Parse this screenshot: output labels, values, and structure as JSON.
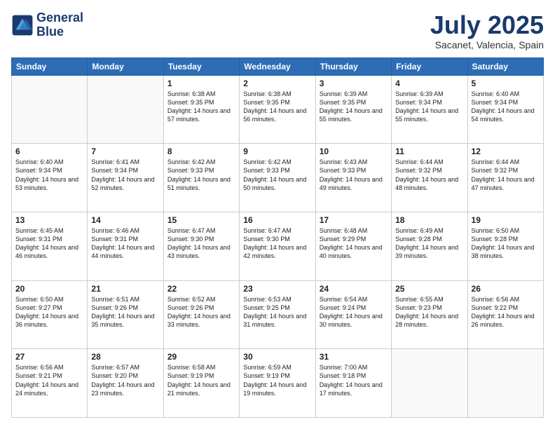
{
  "header": {
    "logo_line1": "General",
    "logo_line2": "Blue",
    "month": "July 2025",
    "location": "Sacanet, Valencia, Spain"
  },
  "weekdays": [
    "Sunday",
    "Monday",
    "Tuesday",
    "Wednesday",
    "Thursday",
    "Friday",
    "Saturday"
  ],
  "weeks": [
    [
      {
        "day": "",
        "text": ""
      },
      {
        "day": "",
        "text": ""
      },
      {
        "day": "1",
        "text": "Sunrise: 6:38 AM\nSunset: 9:35 PM\nDaylight: 14 hours and 57 minutes."
      },
      {
        "day": "2",
        "text": "Sunrise: 6:38 AM\nSunset: 9:35 PM\nDaylight: 14 hours and 56 minutes."
      },
      {
        "day": "3",
        "text": "Sunrise: 6:39 AM\nSunset: 9:35 PM\nDaylight: 14 hours and 55 minutes."
      },
      {
        "day": "4",
        "text": "Sunrise: 6:39 AM\nSunset: 9:34 PM\nDaylight: 14 hours and 55 minutes."
      },
      {
        "day": "5",
        "text": "Sunrise: 6:40 AM\nSunset: 9:34 PM\nDaylight: 14 hours and 54 minutes."
      }
    ],
    [
      {
        "day": "6",
        "text": "Sunrise: 6:40 AM\nSunset: 9:34 PM\nDaylight: 14 hours and 53 minutes."
      },
      {
        "day": "7",
        "text": "Sunrise: 6:41 AM\nSunset: 9:34 PM\nDaylight: 14 hours and 52 minutes."
      },
      {
        "day": "8",
        "text": "Sunrise: 6:42 AM\nSunset: 9:33 PM\nDaylight: 14 hours and 51 minutes."
      },
      {
        "day": "9",
        "text": "Sunrise: 6:42 AM\nSunset: 9:33 PM\nDaylight: 14 hours and 50 minutes."
      },
      {
        "day": "10",
        "text": "Sunrise: 6:43 AM\nSunset: 9:33 PM\nDaylight: 14 hours and 49 minutes."
      },
      {
        "day": "11",
        "text": "Sunrise: 6:44 AM\nSunset: 9:32 PM\nDaylight: 14 hours and 48 minutes."
      },
      {
        "day": "12",
        "text": "Sunrise: 6:44 AM\nSunset: 9:32 PM\nDaylight: 14 hours and 47 minutes."
      }
    ],
    [
      {
        "day": "13",
        "text": "Sunrise: 6:45 AM\nSunset: 9:31 PM\nDaylight: 14 hours and 46 minutes."
      },
      {
        "day": "14",
        "text": "Sunrise: 6:46 AM\nSunset: 9:31 PM\nDaylight: 14 hours and 44 minutes."
      },
      {
        "day": "15",
        "text": "Sunrise: 6:47 AM\nSunset: 9:30 PM\nDaylight: 14 hours and 43 minutes."
      },
      {
        "day": "16",
        "text": "Sunrise: 6:47 AM\nSunset: 9:30 PM\nDaylight: 14 hours and 42 minutes."
      },
      {
        "day": "17",
        "text": "Sunrise: 6:48 AM\nSunset: 9:29 PM\nDaylight: 14 hours and 40 minutes."
      },
      {
        "day": "18",
        "text": "Sunrise: 6:49 AM\nSunset: 9:28 PM\nDaylight: 14 hours and 39 minutes."
      },
      {
        "day": "19",
        "text": "Sunrise: 6:50 AM\nSunset: 9:28 PM\nDaylight: 14 hours and 38 minutes."
      }
    ],
    [
      {
        "day": "20",
        "text": "Sunrise: 6:50 AM\nSunset: 9:27 PM\nDaylight: 14 hours and 36 minutes."
      },
      {
        "day": "21",
        "text": "Sunrise: 6:51 AM\nSunset: 9:26 PM\nDaylight: 14 hours and 35 minutes."
      },
      {
        "day": "22",
        "text": "Sunrise: 6:52 AM\nSunset: 9:26 PM\nDaylight: 14 hours and 33 minutes."
      },
      {
        "day": "23",
        "text": "Sunrise: 6:53 AM\nSunset: 9:25 PM\nDaylight: 14 hours and 31 minutes."
      },
      {
        "day": "24",
        "text": "Sunrise: 6:54 AM\nSunset: 9:24 PM\nDaylight: 14 hours and 30 minutes."
      },
      {
        "day": "25",
        "text": "Sunrise: 6:55 AM\nSunset: 9:23 PM\nDaylight: 14 hours and 28 minutes."
      },
      {
        "day": "26",
        "text": "Sunrise: 6:56 AM\nSunset: 9:22 PM\nDaylight: 14 hours and 26 minutes."
      }
    ],
    [
      {
        "day": "27",
        "text": "Sunrise: 6:56 AM\nSunset: 9:21 PM\nDaylight: 14 hours and 24 minutes."
      },
      {
        "day": "28",
        "text": "Sunrise: 6:57 AM\nSunset: 9:20 PM\nDaylight: 14 hours and 23 minutes."
      },
      {
        "day": "29",
        "text": "Sunrise: 6:58 AM\nSunset: 9:19 PM\nDaylight: 14 hours and 21 minutes."
      },
      {
        "day": "30",
        "text": "Sunrise: 6:59 AM\nSunset: 9:19 PM\nDaylight: 14 hours and 19 minutes."
      },
      {
        "day": "31",
        "text": "Sunrise: 7:00 AM\nSunset: 9:18 PM\nDaylight: 14 hours and 17 minutes."
      },
      {
        "day": "",
        "text": ""
      },
      {
        "day": "",
        "text": ""
      }
    ]
  ]
}
